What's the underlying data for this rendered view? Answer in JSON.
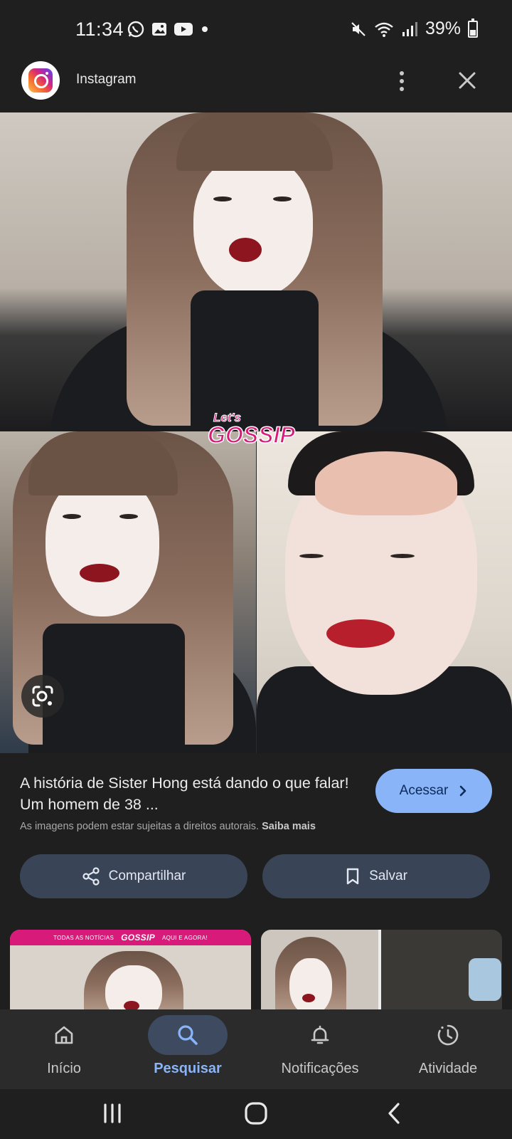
{
  "status_bar": {
    "time": "11:34",
    "battery": "39%",
    "left_icons": [
      "whatsapp-icon",
      "gallery-icon",
      "youtube-icon",
      "dot-icon"
    ],
    "right_icons": [
      "mute-icon",
      "wifi-icon",
      "signal-icon",
      "battery-icon"
    ]
  },
  "source": {
    "name": "Instagram",
    "logo": "instagram-logo"
  },
  "image": {
    "overlay_logo": "Let's GOSSIP",
    "lens_icon": "google-lens-icon"
  },
  "caption": {
    "title": "A história de Sister Hong está dando o que falar! Um homem de 38 ...",
    "copyright_note": "As imagens podem estar sujeitas a direitos autorais.",
    "learn_more": "Saiba mais",
    "visit_label": "Acessar"
  },
  "actions": {
    "share_label": "Compartilhar",
    "save_label": "Salvar"
  },
  "related": {
    "banner_left": "TODAS AS NOTÍCIAS",
    "banner_brand": "GOSSIP",
    "banner_right": "AQUI E AGORA!"
  },
  "bottom_nav": [
    {
      "label": "Início",
      "icon": "home-icon",
      "active": false
    },
    {
      "label": "Pesquisar",
      "icon": "search-icon",
      "active": true
    },
    {
      "label": "Notificações",
      "icon": "bell-icon",
      "active": false
    },
    {
      "label": "Atividade",
      "icon": "activity-icon",
      "active": false
    }
  ],
  "colors": {
    "background": "#1f1f1f",
    "accent": "#8ab4f8",
    "button_bg": "#394457",
    "nav_bg": "#2b2b2b",
    "brand_pink": "#d81b7a"
  }
}
